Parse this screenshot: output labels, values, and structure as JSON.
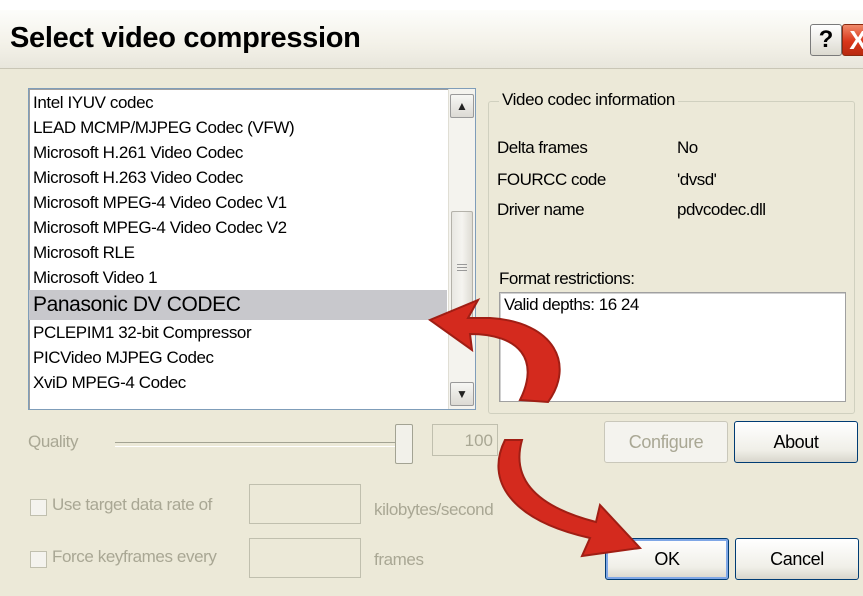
{
  "window": {
    "title": "Select video compression",
    "help_label": "?",
    "close_label": "X"
  },
  "codec_list": {
    "items": [
      "Intel IYUV codec",
      "LEAD MCMP/MJPEG Codec (VFW)",
      "Microsoft H.261 Video Codec",
      "Microsoft H.263 Video Codec",
      "Microsoft MPEG-4 Video Codec V1",
      "Microsoft MPEG-4 Video Codec V2",
      "Microsoft RLE",
      "Microsoft Video 1",
      "Panasonic DV CODEC",
      "PCLEPIM1 32-bit Compressor",
      "PICVideo MJPEG Codec",
      "XviD MPEG-4 Codec"
    ],
    "selected_index": 8,
    "scroll_up_icon": "chevron-up-icon",
    "scroll_down_icon": "chevron-down-icon"
  },
  "info": {
    "legend": "Video codec information",
    "rows": [
      {
        "label": "Delta frames",
        "value": "No"
      },
      {
        "label": "FOURCC code",
        "value": "'dvsd'"
      },
      {
        "label": "Driver name",
        "value": "pdvcodec.dll"
      }
    ],
    "restrictions_label": "Format restrictions:",
    "restrictions_value": "Valid depths: 16 24"
  },
  "quality": {
    "label": "Quality",
    "value": "100",
    "level": 1.0
  },
  "buttons": {
    "configure": "Configure",
    "about": "About",
    "ok": "OK",
    "cancel": "Cancel"
  },
  "options": {
    "target_rate_label": "Use target data rate of",
    "target_rate_unit": "kilobytes/second",
    "target_rate_checked": false,
    "keyframes_label": "Force keyframes every",
    "keyframes_unit": "frames",
    "keyframes_checked": false
  },
  "colors": {
    "dialog_bg": "#ece9d8",
    "selection": "#c8c8cc",
    "annotation_arrow": "#d42a1e"
  }
}
